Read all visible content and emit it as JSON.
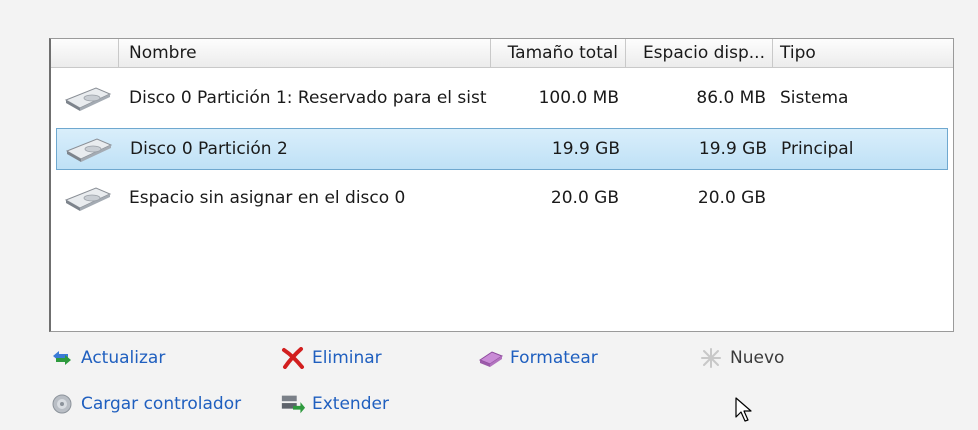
{
  "columns": {
    "name": "Nombre",
    "total_size": "Tamaño total",
    "free_space": "Espacio disp...",
    "type": "Tipo"
  },
  "rows": [
    {
      "icon": "disk-icon",
      "name": "Disco 0 Partición 1: Reservado para el sist",
      "total_size": "100.0 MB",
      "free_space": "86.0 MB",
      "type": "Sistema",
      "selected": false
    },
    {
      "icon": "disk-icon",
      "name": "Disco 0 Partición 2",
      "total_size": "19.9 GB",
      "free_space": "19.9 GB",
      "type": "Principal",
      "selected": true
    },
    {
      "icon": "disk-icon",
      "name": "Espacio sin asignar en el disco 0",
      "total_size": "20.0 GB",
      "free_space": "20.0 GB",
      "type": "",
      "selected": false
    }
  ],
  "actions": {
    "refresh": {
      "label": "Actualizar",
      "icon": "refresh-icon",
      "enabled": true
    },
    "delete": {
      "label": "Eliminar",
      "icon": "delete-x-icon",
      "enabled": true
    },
    "format": {
      "label": "Formatear",
      "icon": "eraser-icon",
      "enabled": true
    },
    "new": {
      "label": "Nuevo",
      "icon": "sparkle-icon",
      "enabled": false
    },
    "load_driver": {
      "label": "Cargar controlador",
      "icon": "cd-icon",
      "enabled": true
    },
    "extend": {
      "label": "Extender",
      "icon": "extend-disk-icon",
      "enabled": true
    }
  },
  "colors": {
    "link": "#1f5fbf",
    "selection_fill": "#c8e5f8",
    "selection_border": "#6fa8cf",
    "delete_red": "#d21f1f"
  }
}
